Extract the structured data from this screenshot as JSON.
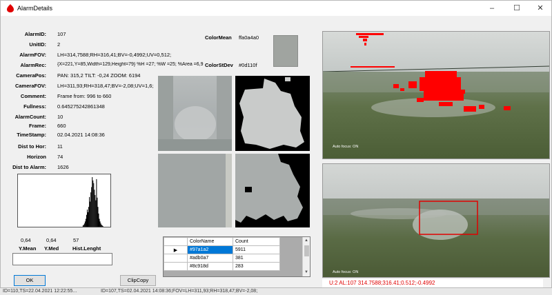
{
  "window": {
    "title": "AlarmDetails",
    "minimize": "–",
    "maximize": "☐",
    "close": "✕"
  },
  "fields": [
    {
      "label": "AlarmID:",
      "value": "107"
    },
    {
      "label": "UnitID:",
      "value": "2"
    },
    {
      "label": "AlarmFOV:",
      "value": "LH=314,7588;RH=316,41;BV=-0,4992;UV=0,512;"
    },
    {
      "label": "AlarmRec:",
      "value": "{X=221,Y=85,Width=129,Height=79} %H =27; %W =25; %Area =6,9"
    },
    {
      "label": "CameraPos:",
      "value": "PAN: 315,2 TILT: -0,24 ZOOM: 6194"
    },
    {
      "label": "CameraFOV:",
      "value": "LH=311,93;RH=318,47;BV=-2,08;UV=1,6;"
    },
    {
      "label": "Comment:",
      "value": "Frame from: 996 to 660"
    },
    {
      "label": "Fullness:",
      "value": "0.645275242861348"
    },
    {
      "label": "AlarmCount:",
      "value": "10"
    },
    {
      "label": "Frame:",
      "value": "660"
    },
    {
      "label": "TimeStamp:",
      "value": "02.04.2021 14:08:36"
    },
    {
      "label": "Dist to Hor:",
      "value": "11"
    },
    {
      "label": "Horizon",
      "value": "74"
    },
    {
      "label": "Dist to Alarm:",
      "value": "1626"
    }
  ],
  "color": {
    "mean_label": "ColorMean",
    "mean_value": "ffa0a4a0",
    "stdev_label": "ColorStDev",
    "stdev_value": "#0d110f",
    "swatch": "#a0a4a0"
  },
  "stats": {
    "mean_value": "0,64",
    "med_value": "0,64",
    "hist_value": "57",
    "mean_label": "Y.Mean",
    "med_label": "Y.Med",
    "hist_label": "Hist.Lenght"
  },
  "histogram": [
    0,
    0,
    0,
    0,
    0,
    0,
    0,
    0,
    0,
    0,
    0,
    0,
    0,
    0,
    0,
    0,
    0,
    0,
    0,
    0,
    0,
    0,
    0,
    0,
    0,
    0,
    0,
    0,
    0,
    0,
    0,
    0,
    0,
    0,
    0,
    0,
    0,
    0,
    0,
    0,
    0,
    0,
    0,
    0,
    0,
    0,
    0,
    0,
    0,
    0,
    0,
    0,
    0,
    0,
    0,
    0,
    0,
    0,
    0,
    0,
    0,
    0,
    0,
    0,
    0,
    0,
    0,
    0,
    0,
    0,
    0,
    0,
    0,
    0,
    0,
    0,
    0,
    0,
    0,
    0,
    0,
    0,
    0,
    0,
    0,
    0,
    0,
    0,
    0,
    0,
    0,
    2,
    3,
    5,
    8,
    12,
    18,
    26,
    22,
    30,
    45,
    38,
    52,
    60,
    75,
    70,
    66,
    56,
    48,
    40,
    72,
    44,
    30,
    20,
    12,
    8,
    5,
    3,
    2,
    1,
    0,
    0,
    0,
    0,
    0,
    0,
    0,
    0,
    0,
    0
  ],
  "buttons": {
    "ok": "OK",
    "clipcopy": "ClipCopy"
  },
  "grid": {
    "columns": [
      "ColorName",
      "Count"
    ],
    "rows": [
      {
        "name": "#97a1a2",
        "count": "5911"
      },
      {
        "name": "#adb0a7",
        "count": "381"
      },
      {
        "name": "#8c918d",
        "count": "283"
      }
    ],
    "row_marker": "▶",
    "scroll_up": "▲",
    "scroll_down": "▼"
  },
  "camera": {
    "autofocus_top": "Auto focus: ON",
    "autofocus_bottom": "Auto focus: ON",
    "status": "U:2 AL:107   314.7588;316.41;0.512;-0.4992"
  },
  "background": {
    "bottom_left": "ID=110,TS=22.04.2021 12:22:55...",
    "bottom_mid": "ID=107,TS=02.04.2021 14:08:36;FOV=LH=311,93;RH=318,47;BV=-2,08;"
  },
  "colors": {
    "alarm_red": "#ff0000",
    "accent": "#0078d7"
  }
}
